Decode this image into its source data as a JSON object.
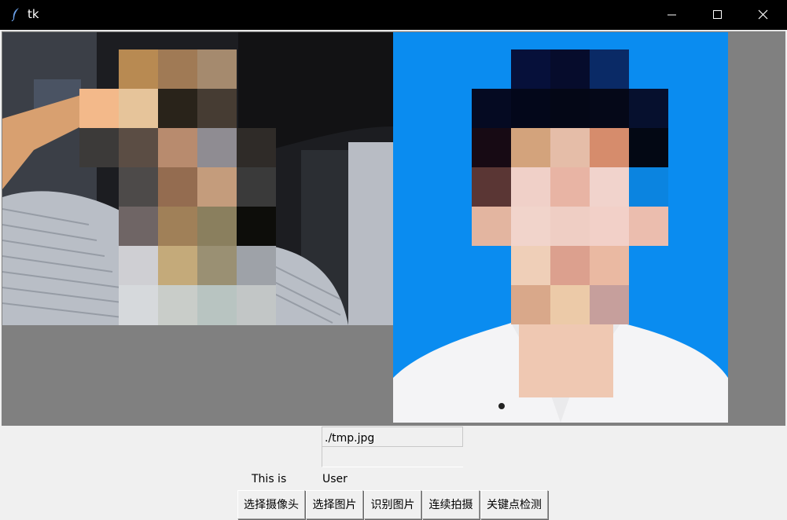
{
  "window": {
    "title": "tk",
    "icon": "feather-icon",
    "title_bar_color": "#000000"
  },
  "canvas": {
    "background": "#808080",
    "photo_background": "#0a8cf0"
  },
  "path_entry": {
    "value": "./tmp.jpg"
  },
  "result": {
    "prefix": "This is",
    "name": "User"
  },
  "buttons": {
    "select_camera": "选择摄像头",
    "select_image": "选择图片",
    "recognize_image": "识别图片",
    "continuous_capture": "连续拍摄",
    "keypoint_detection": "关键点检测"
  }
}
